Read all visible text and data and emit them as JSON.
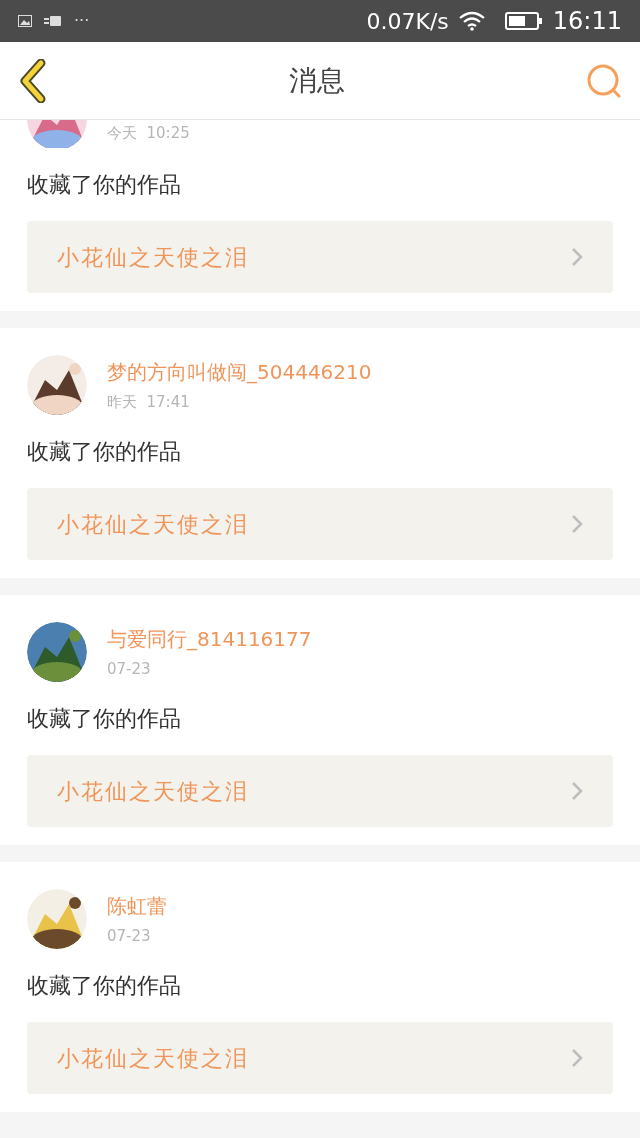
{
  "status_bar": {
    "left_text": "···",
    "speed": "0.07K/s",
    "time": "16:11"
  },
  "header": {
    "title": "消息"
  },
  "messages": [
    {
      "time": "今天  10:25",
      "action": "收藏了你的作品",
      "work": "小花仙之天使之泪"
    },
    {
      "name": "梦的方向叫做闯_504446210",
      "time": "昨天  17:41",
      "action": "收藏了你的作品",
      "work": "小花仙之天使之泪"
    },
    {
      "name": "与爱同行_814116177",
      "time": "07-23",
      "action": "收藏了你的作品",
      "work": "小花仙之天使之泪"
    },
    {
      "name": "陈虹蕾",
      "time": "07-23",
      "action": "收藏了你的作品",
      "work": "小花仙之天使之泪"
    }
  ]
}
